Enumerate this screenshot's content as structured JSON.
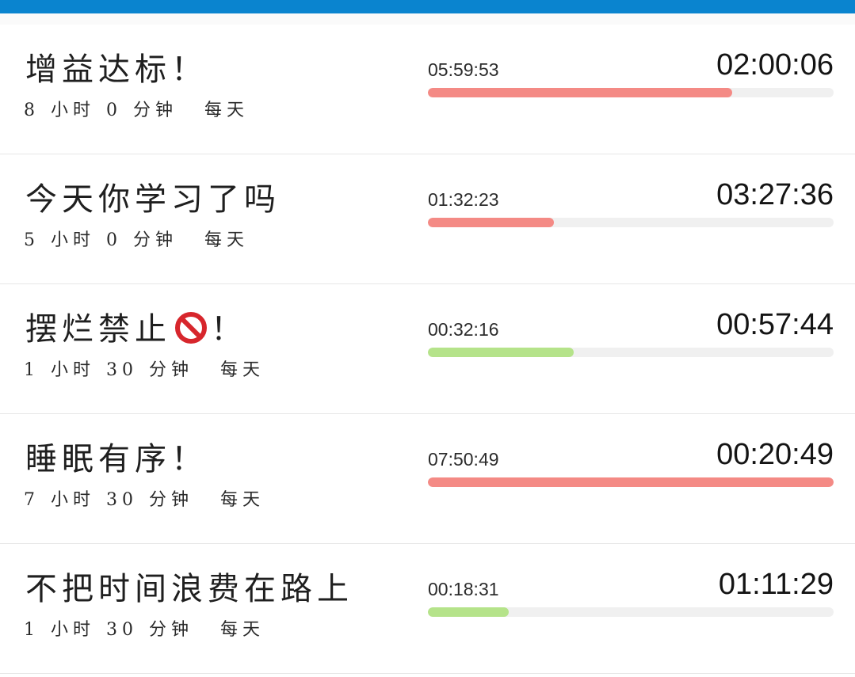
{
  "colors": {
    "topbar": "#0a84cf",
    "red": "#f48a85",
    "green": "#b5e38a"
  },
  "items": [
    {
      "title": "增益达标！",
      "sub": {
        "hours": "8",
        "hours_unit": "小时",
        "minutes": "0",
        "minutes_unit": "分钟",
        "freq": "每天"
      },
      "elapsed": "05:59:53",
      "remaining": "02:00:06",
      "progress": 0.75,
      "color": "red"
    },
    {
      "title": "今天你学习了吗",
      "sub": {
        "hours": "5",
        "hours_unit": "小时",
        "minutes": "0",
        "minutes_unit": "分钟",
        "freq": "每天"
      },
      "elapsed": "01:32:23",
      "remaining": "03:27:36",
      "progress": 0.31,
      "color": "red"
    },
    {
      "title_before_icon": "摆烂禁止",
      "icon": "no-entry-icon",
      "title_after_icon": "！",
      "sub": {
        "hours": "1",
        "hours_unit": "小时",
        "minutes": "30",
        "minutes_unit": "分钟",
        "freq": "每天"
      },
      "elapsed": "00:32:16",
      "remaining": "00:57:44",
      "progress": 0.36,
      "color": "green"
    },
    {
      "title": "睡眠有序！",
      "sub": {
        "hours": "7",
        "hours_unit": "小时",
        "minutes": "30",
        "minutes_unit": "分钟",
        "freq": "每天"
      },
      "elapsed": "07:50:49",
      "remaining": "00:20:49",
      "progress": 1.0,
      "color": "red"
    },
    {
      "title": "不把时间浪费在路上",
      "sub": {
        "hours": "1",
        "hours_unit": "小时",
        "minutes": "30",
        "minutes_unit": "分钟",
        "freq": "每天"
      },
      "elapsed": "00:18:31",
      "remaining": "01:11:29",
      "progress": 0.2,
      "color": "green"
    }
  ]
}
